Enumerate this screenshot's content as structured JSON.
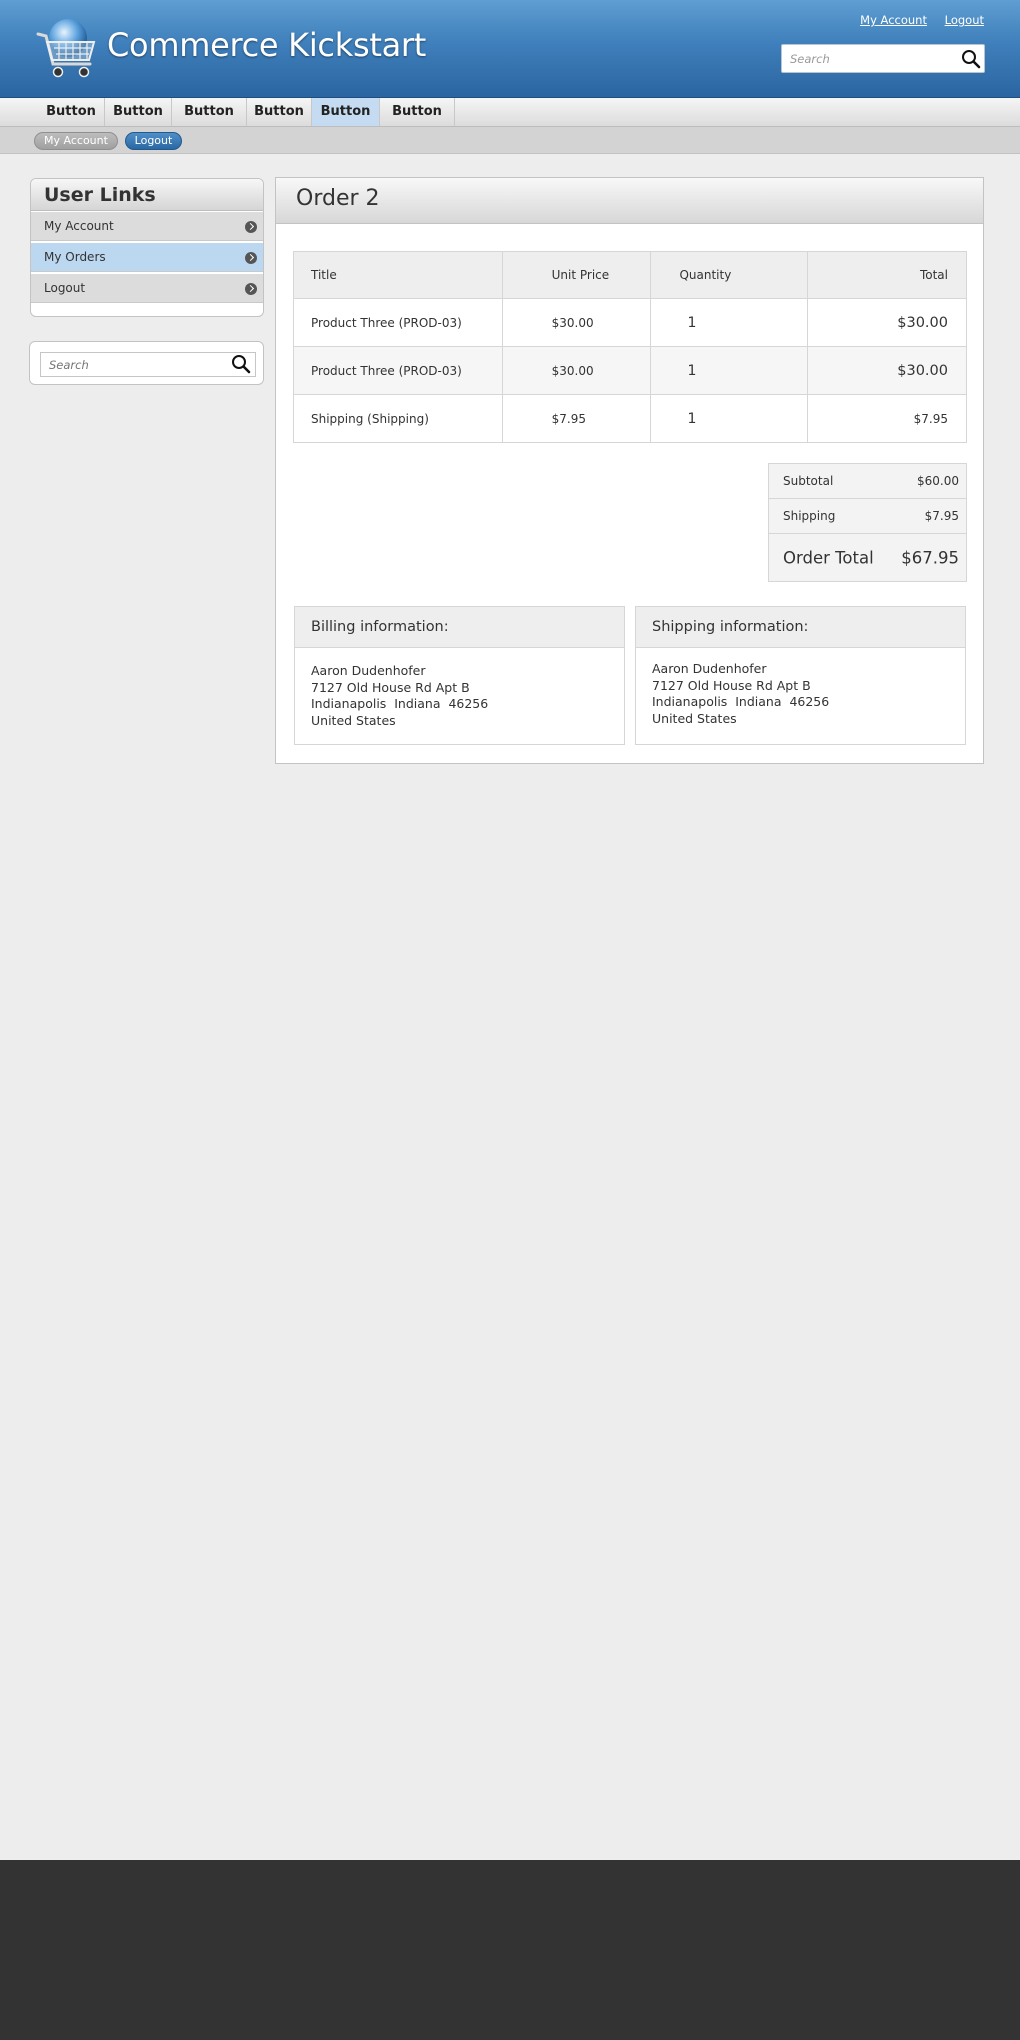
{
  "header": {
    "site_name": "Commerce Kickstart",
    "links": [
      "My Account",
      "Logout"
    ],
    "search_placeholder": "Search"
  },
  "primary_nav": {
    "items": [
      "Button",
      "Button",
      "Button",
      "Button",
      "Button",
      "Button"
    ],
    "active_index": 4
  },
  "secondary_nav": {
    "items": [
      "My Account",
      "Logout"
    ],
    "active_index": 1
  },
  "sidebar": {
    "title": "User Links",
    "items": [
      "My Account",
      "My Orders",
      "Logout"
    ],
    "active_index": 1,
    "search_placeholder": "Search"
  },
  "order": {
    "title": "Order 2",
    "columns": [
      "Title",
      "Unit Price",
      "Quantity",
      "Total"
    ],
    "rows": [
      {
        "title": "Product Three (PROD-03)",
        "unit_price": "$30.00",
        "quantity": "1",
        "total": "$30.00"
      },
      {
        "title": "Product Three (PROD-03)",
        "unit_price": "$30.00",
        "quantity": "1",
        "total": "$30.00"
      },
      {
        "title": "Shipping (Shipping)",
        "unit_price": "$7.95",
        "quantity": "1",
        "total": "$7.95"
      }
    ],
    "totals": {
      "subtotal_label": "Subtotal",
      "subtotal": "$60.00",
      "shipping_label": "Shipping",
      "shipping": "$7.95",
      "order_total_label": "Order Total",
      "order_total": "$67.95"
    },
    "billing": {
      "heading": "Billing information:",
      "name": "Aaron Dudenhofer",
      "street": "7127 Old House Rd Apt B",
      "city_line": "Indianapolis  Indiana  46256",
      "country": "United States"
    },
    "shipping_info": {
      "heading": "Shipping information:",
      "name": "Aaron Dudenhofer",
      "street": "7127 Old House Rd Apt B",
      "city_line": "Indianapolis  Indiana  46256",
      "country": "United States"
    }
  },
  "colors": {
    "header_blue": "#2a65a1",
    "active_nav": "#c4dbf1",
    "footer": "#333333",
    "background": "#ededed"
  },
  "icons": [
    "shopping-cart-logo-icon",
    "search-icon",
    "chevron-right-icon"
  ]
}
